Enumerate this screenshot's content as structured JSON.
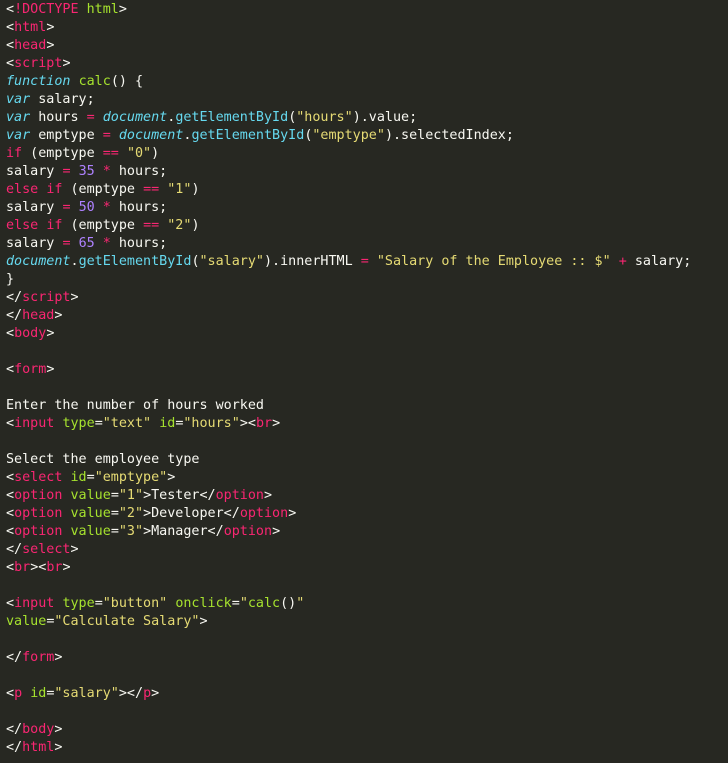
{
  "editor": {
    "theme_colors": {
      "background": "#272822",
      "plain": "#f8f8f2",
      "tag": "#f92672",
      "attr": "#a6e22e",
      "string": "#e6db74",
      "keyword": "#66d9ef",
      "number": "#ae81ff"
    },
    "lines": [
      [
        {
          "t": "<",
          "c": "plain"
        },
        {
          "t": "!DOCTYPE",
          "c": "tag"
        },
        {
          "t": " ",
          "c": "plain"
        },
        {
          "t": "html",
          "c": "attr"
        },
        {
          "t": ">",
          "c": "plain"
        }
      ],
      [
        {
          "t": "<",
          "c": "plain"
        },
        {
          "t": "html",
          "c": "tag"
        },
        {
          "t": ">",
          "c": "plain"
        }
      ],
      [
        {
          "t": "<",
          "c": "plain"
        },
        {
          "t": "head",
          "c": "tag"
        },
        {
          "t": ">",
          "c": "plain"
        }
      ],
      [
        {
          "t": "<",
          "c": "plain"
        },
        {
          "t": "script",
          "c": "tag"
        },
        {
          "t": ">",
          "c": "plain"
        }
      ],
      [
        {
          "t": "function",
          "c": "keyword-i"
        },
        {
          "t": " ",
          "c": "plain"
        },
        {
          "t": "calc",
          "c": "attr"
        },
        {
          "t": "() {",
          "c": "plain"
        }
      ],
      [
        {
          "t": "var",
          "c": "keyword-i"
        },
        {
          "t": " salary;",
          "c": "plain"
        }
      ],
      [
        {
          "t": "var",
          "c": "keyword-i"
        },
        {
          "t": " hours ",
          "c": "plain"
        },
        {
          "t": "=",
          "c": "tag"
        },
        {
          "t": " ",
          "c": "plain"
        },
        {
          "t": "document",
          "c": "keyword-i"
        },
        {
          "t": ".",
          "c": "plain"
        },
        {
          "t": "getElementById",
          "c": "keyword"
        },
        {
          "t": "(",
          "c": "plain"
        },
        {
          "t": "\"hours\"",
          "c": "string"
        },
        {
          "t": ").value;",
          "c": "plain"
        }
      ],
      [
        {
          "t": "var",
          "c": "keyword-i"
        },
        {
          "t": " emptype ",
          "c": "plain"
        },
        {
          "t": "=",
          "c": "tag"
        },
        {
          "t": " ",
          "c": "plain"
        },
        {
          "t": "document",
          "c": "keyword-i"
        },
        {
          "t": ".",
          "c": "plain"
        },
        {
          "t": "getElementById",
          "c": "keyword"
        },
        {
          "t": "(",
          "c": "plain"
        },
        {
          "t": "\"emptype\"",
          "c": "string"
        },
        {
          "t": ").selectedIndex;",
          "c": "plain"
        }
      ],
      [
        {
          "t": "if",
          "c": "tag"
        },
        {
          "t": " (emptype ",
          "c": "plain"
        },
        {
          "t": "==",
          "c": "tag"
        },
        {
          "t": " ",
          "c": "plain"
        },
        {
          "t": "\"0\"",
          "c": "string"
        },
        {
          "t": ")",
          "c": "plain"
        }
      ],
      [
        {
          "t": "salary ",
          "c": "plain"
        },
        {
          "t": "=",
          "c": "tag"
        },
        {
          "t": " ",
          "c": "plain"
        },
        {
          "t": "35",
          "c": "number"
        },
        {
          "t": " ",
          "c": "plain"
        },
        {
          "t": "*",
          "c": "tag"
        },
        {
          "t": " hours;",
          "c": "plain"
        }
      ],
      [
        {
          "t": "else",
          "c": "tag"
        },
        {
          "t": " ",
          "c": "plain"
        },
        {
          "t": "if",
          "c": "tag"
        },
        {
          "t": " (emptype ",
          "c": "plain"
        },
        {
          "t": "==",
          "c": "tag"
        },
        {
          "t": " ",
          "c": "plain"
        },
        {
          "t": "\"1\"",
          "c": "string"
        },
        {
          "t": ")",
          "c": "plain"
        }
      ],
      [
        {
          "t": "salary ",
          "c": "plain"
        },
        {
          "t": "=",
          "c": "tag"
        },
        {
          "t": " ",
          "c": "plain"
        },
        {
          "t": "50",
          "c": "number"
        },
        {
          "t": " ",
          "c": "plain"
        },
        {
          "t": "*",
          "c": "tag"
        },
        {
          "t": " hours;",
          "c": "plain"
        }
      ],
      [
        {
          "t": "else",
          "c": "tag"
        },
        {
          "t": " ",
          "c": "plain"
        },
        {
          "t": "if",
          "c": "tag"
        },
        {
          "t": " (emptype ",
          "c": "plain"
        },
        {
          "t": "==",
          "c": "tag"
        },
        {
          "t": " ",
          "c": "plain"
        },
        {
          "t": "\"2\"",
          "c": "string"
        },
        {
          "t": ")",
          "c": "plain"
        }
      ],
      [
        {
          "t": "salary ",
          "c": "plain"
        },
        {
          "t": "=",
          "c": "tag"
        },
        {
          "t": " ",
          "c": "plain"
        },
        {
          "t": "65",
          "c": "number"
        },
        {
          "t": " ",
          "c": "plain"
        },
        {
          "t": "*",
          "c": "tag"
        },
        {
          "t": " hours;",
          "c": "plain"
        }
      ],
      [
        {
          "t": "document",
          "c": "keyword-i"
        },
        {
          "t": ".",
          "c": "plain"
        },
        {
          "t": "getElementById",
          "c": "keyword"
        },
        {
          "t": "(",
          "c": "plain"
        },
        {
          "t": "\"salary\"",
          "c": "string"
        },
        {
          "t": ").innerHTML ",
          "c": "plain"
        },
        {
          "t": "=",
          "c": "tag"
        },
        {
          "t": " ",
          "c": "plain"
        },
        {
          "t": "\"Salary of the Employee :: $\"",
          "c": "string"
        },
        {
          "t": " ",
          "c": "plain"
        },
        {
          "t": "+",
          "c": "tag"
        },
        {
          "t": " salary;",
          "c": "plain"
        }
      ],
      [
        {
          "t": "}",
          "c": "plain"
        }
      ],
      [
        {
          "t": "</",
          "c": "plain"
        },
        {
          "t": "script",
          "c": "tag"
        },
        {
          "t": ">",
          "c": "plain"
        }
      ],
      [
        {
          "t": "</",
          "c": "plain"
        },
        {
          "t": "head",
          "c": "tag"
        },
        {
          "t": ">",
          "c": "plain"
        }
      ],
      [
        {
          "t": "<",
          "c": "plain"
        },
        {
          "t": "body",
          "c": "tag"
        },
        {
          "t": ">",
          "c": "plain"
        }
      ],
      [],
      [
        {
          "t": "<",
          "c": "plain"
        },
        {
          "t": "form",
          "c": "tag"
        },
        {
          "t": ">",
          "c": "plain"
        }
      ],
      [],
      [
        {
          "t": "Enter the number of hours worked",
          "c": "plain"
        }
      ],
      [
        {
          "t": "<",
          "c": "plain"
        },
        {
          "t": "input",
          "c": "tag"
        },
        {
          "t": " ",
          "c": "plain"
        },
        {
          "t": "type",
          "c": "attr"
        },
        {
          "t": "=",
          "c": "plain"
        },
        {
          "t": "\"text\"",
          "c": "string"
        },
        {
          "t": " ",
          "c": "plain"
        },
        {
          "t": "id",
          "c": "attr"
        },
        {
          "t": "=",
          "c": "plain"
        },
        {
          "t": "\"hours\"",
          "c": "string"
        },
        {
          "t": "><",
          "c": "plain"
        },
        {
          "t": "br",
          "c": "tag"
        },
        {
          "t": ">",
          "c": "plain"
        }
      ],
      [],
      [
        {
          "t": "Select the employee type",
          "c": "plain"
        }
      ],
      [
        {
          "t": "<",
          "c": "plain"
        },
        {
          "t": "select",
          "c": "tag"
        },
        {
          "t": " ",
          "c": "plain"
        },
        {
          "t": "id",
          "c": "attr"
        },
        {
          "t": "=",
          "c": "plain"
        },
        {
          "t": "\"emptype\"",
          "c": "string"
        },
        {
          "t": ">",
          "c": "plain"
        }
      ],
      [
        {
          "t": "<",
          "c": "plain"
        },
        {
          "t": "option",
          "c": "tag"
        },
        {
          "t": " ",
          "c": "plain"
        },
        {
          "t": "value",
          "c": "attr"
        },
        {
          "t": "=",
          "c": "plain"
        },
        {
          "t": "\"1\"",
          "c": "string"
        },
        {
          "t": ">Tester</",
          "c": "plain"
        },
        {
          "t": "option",
          "c": "tag"
        },
        {
          "t": ">",
          "c": "plain"
        }
      ],
      [
        {
          "t": "<",
          "c": "plain"
        },
        {
          "t": "option",
          "c": "tag"
        },
        {
          "t": " ",
          "c": "plain"
        },
        {
          "t": "value",
          "c": "attr"
        },
        {
          "t": "=",
          "c": "plain"
        },
        {
          "t": "\"2\"",
          "c": "string"
        },
        {
          "t": ">Developer</",
          "c": "plain"
        },
        {
          "t": "option",
          "c": "tag"
        },
        {
          "t": ">",
          "c": "plain"
        }
      ],
      [
        {
          "t": "<",
          "c": "plain"
        },
        {
          "t": "option",
          "c": "tag"
        },
        {
          "t": " ",
          "c": "plain"
        },
        {
          "t": "value",
          "c": "attr"
        },
        {
          "t": "=",
          "c": "plain"
        },
        {
          "t": "\"3\"",
          "c": "string"
        },
        {
          "t": ">Manager</",
          "c": "plain"
        },
        {
          "t": "option",
          "c": "tag"
        },
        {
          "t": ">",
          "c": "plain"
        }
      ],
      [
        {
          "t": "</",
          "c": "plain"
        },
        {
          "t": "select",
          "c": "tag"
        },
        {
          "t": ">",
          "c": "plain"
        }
      ],
      [
        {
          "t": "<",
          "c": "plain"
        },
        {
          "t": "br",
          "c": "tag"
        },
        {
          "t": "><",
          "c": "plain"
        },
        {
          "t": "br",
          "c": "tag"
        },
        {
          "t": ">",
          "c": "plain"
        }
      ],
      [],
      [
        {
          "t": "<",
          "c": "plain"
        },
        {
          "t": "input",
          "c": "tag"
        },
        {
          "t": " ",
          "c": "plain"
        },
        {
          "t": "type",
          "c": "attr"
        },
        {
          "t": "=",
          "c": "plain"
        },
        {
          "t": "\"button\"",
          "c": "string"
        },
        {
          "t": " ",
          "c": "plain"
        },
        {
          "t": "onclick",
          "c": "attr"
        },
        {
          "t": "=",
          "c": "plain"
        },
        {
          "t": "\"",
          "c": "string"
        },
        {
          "t": "calc",
          "c": "attr"
        },
        {
          "t": "()",
          "c": "plain"
        },
        {
          "t": "\"",
          "c": "string"
        }
      ],
      [
        {
          "t": "value",
          "c": "attr"
        },
        {
          "t": "=",
          "c": "plain"
        },
        {
          "t": "\"Calculate Salary\"",
          "c": "string"
        },
        {
          "t": ">",
          "c": "plain"
        }
      ],
      [],
      [
        {
          "t": "</",
          "c": "plain"
        },
        {
          "t": "form",
          "c": "tag"
        },
        {
          "t": ">",
          "c": "plain"
        }
      ],
      [],
      [
        {
          "t": "<",
          "c": "plain"
        },
        {
          "t": "p",
          "c": "tag"
        },
        {
          "t": " ",
          "c": "plain"
        },
        {
          "t": "id",
          "c": "attr"
        },
        {
          "t": "=",
          "c": "plain"
        },
        {
          "t": "\"salary\"",
          "c": "string"
        },
        {
          "t": "></",
          "c": "plain"
        },
        {
          "t": "p",
          "c": "tag"
        },
        {
          "t": ">",
          "c": "plain"
        }
      ],
      [],
      [
        {
          "t": "</",
          "c": "plain"
        },
        {
          "t": "body",
          "c": "tag"
        },
        {
          "t": ">",
          "c": "plain"
        }
      ],
      [
        {
          "t": "</",
          "c": "plain"
        },
        {
          "t": "html",
          "c": "tag"
        },
        {
          "t": ">",
          "c": "plain"
        }
      ]
    ]
  }
}
